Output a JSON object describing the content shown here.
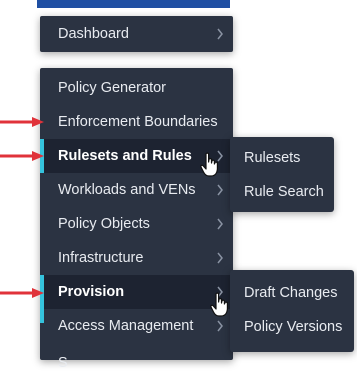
{
  "menu": {
    "dashboard": "Dashboard",
    "items": [
      "Policy Generator",
      "Enforcement Boundaries",
      "Rulesets and Rules",
      "Workloads and VENs",
      "Policy Objects",
      "Infrastructure",
      "Provision",
      "Access Management"
    ],
    "clipped_item": "S"
  },
  "rulesets_submenu": [
    "Rulesets",
    "Rule Search"
  ],
  "provision_submenu": [
    "Draft Changes",
    "Policy Versions"
  ],
  "colors": {
    "menu_bg": "#2b3342",
    "active_bg": "#1d2331",
    "accent": "#35c3dd",
    "annotation_arrow": "#e0323a",
    "top_bar": "#1f4fa3"
  },
  "icons": {
    "chevron": "chevron-right-icon",
    "pointer": "hand-pointer-icon",
    "annotation": "red-arrow-icon"
  }
}
